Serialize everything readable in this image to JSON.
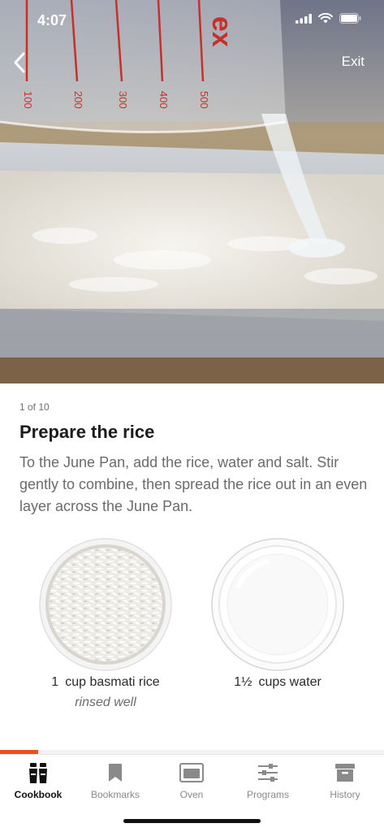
{
  "status": {
    "time": "4:07"
  },
  "nav": {
    "exit_label": "Exit"
  },
  "step": {
    "counter": "1 of 10",
    "title": "Prepare the rice",
    "description": "To the June Pan, add the rice, water and salt. Stir gently to combine, then spread the rice out in an even layer across the June Pan."
  },
  "hero": {
    "cup_marks": [
      "100",
      "200",
      "300",
      "400",
      "500"
    ],
    "cup_brand": "ex"
  },
  "ingredients": [
    {
      "qty": "1",
      "name": "cup basmati rice",
      "note": "rinsed well"
    },
    {
      "qty": "1½",
      "name": "cups water",
      "note": ""
    }
  ],
  "progress": {
    "current": 1,
    "total": 10,
    "fraction": 0.1
  },
  "tabs": [
    {
      "label": "Cookbook",
      "icon": "cookbook-icon",
      "active": true
    },
    {
      "label": "Bookmarks",
      "icon": "bookmark-icon",
      "active": false
    },
    {
      "label": "Oven",
      "icon": "oven-icon",
      "active": false
    },
    {
      "label": "Programs",
      "icon": "sliders-icon",
      "active": false
    },
    {
      "label": "History",
      "icon": "archive-box-icon",
      "active": false
    }
  ],
  "colors": {
    "accent": "#e8501c",
    "tab_active": "#111111",
    "tab_inactive": "#8a8a8a"
  }
}
